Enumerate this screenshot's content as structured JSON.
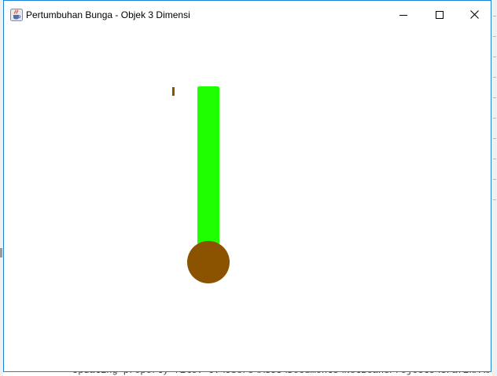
{
  "window": {
    "title": "Pertumbuhan Bunga - Objek 3 Dimensi",
    "controls": {
      "minimize_icon": "minimize-icon",
      "maximize_icon": "maximize-icon",
      "close_icon": "close-icon"
    },
    "app_icon": "java-cup-icon",
    "accent_border": "#1883d7"
  },
  "scene": {
    "stem_color": "#1eff00",
    "pot_color": "#8b5300"
  },
  "background": {
    "console_line": "Updating property file: C:\\Users\\ASUS\\Documents\\NetBeansProjects\\GrafikA\\bui"
  }
}
